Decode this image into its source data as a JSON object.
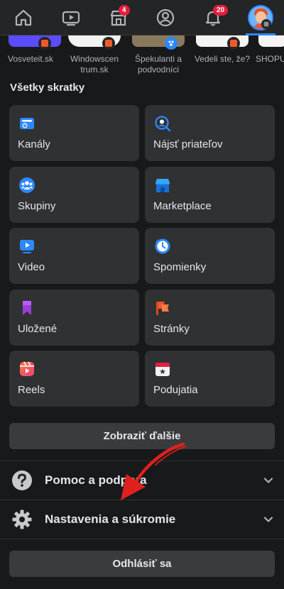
{
  "nav": {
    "marketplace_badge": "4",
    "notifications_badge": "20"
  },
  "strip": [
    {
      "label": "Vosveteit.sk"
    },
    {
      "label": "Windowscen trum.sk"
    },
    {
      "label": "Špekulanti a podvodníci"
    },
    {
      "label": "Vedeli ste, že?"
    },
    {
      "label": "SHOPU"
    }
  ],
  "section_title": "Všetky skratky",
  "shortcuts": [
    {
      "label": "Kanály",
      "icon": "feeds-icon"
    },
    {
      "label": "Nájsť priateľov",
      "icon": "find-friends-icon"
    },
    {
      "label": "Skupiny",
      "icon": "groups-icon"
    },
    {
      "label": "Marketplace",
      "icon": "marketplace-icon"
    },
    {
      "label": "Video",
      "icon": "video-icon"
    },
    {
      "label": "Spomienky",
      "icon": "memories-icon"
    },
    {
      "label": "Uložené",
      "icon": "saved-icon"
    },
    {
      "label": "Stránky",
      "icon": "pages-icon"
    },
    {
      "label": "Reels",
      "icon": "reels-icon"
    },
    {
      "label": "Podujatia",
      "icon": "events-icon"
    }
  ],
  "see_more": "Zobraziť ďalšie",
  "help_row": "Pomoc a podpora",
  "settings_row": "Nastavenia a súkromie",
  "logout": "Odhlásiť sa",
  "colors": {
    "background": "#18191a",
    "tile": "#303133",
    "accent": "#2d88ff",
    "badge": "#e41e3f",
    "annotation_arrow": "#e0201f"
  }
}
